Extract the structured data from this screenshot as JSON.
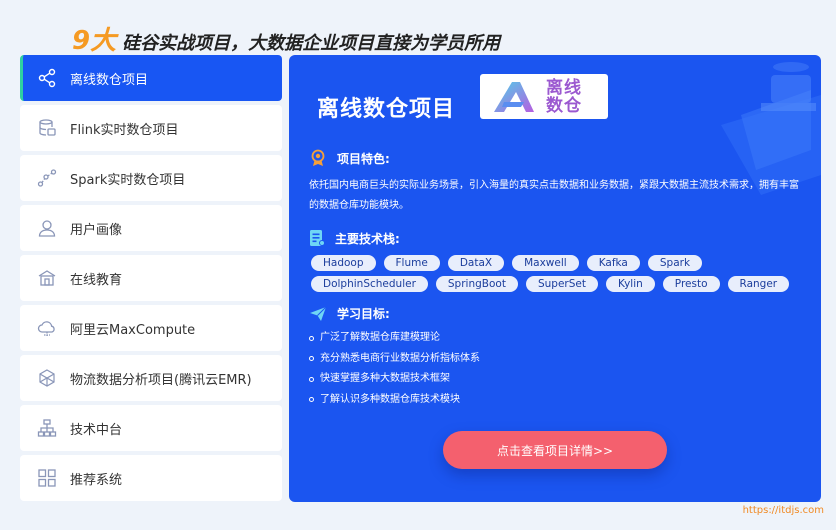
{
  "header": {
    "num": "9大",
    "rest": "硅谷实战项目，大数据企业项目直接为学员所用"
  },
  "sidebar": {
    "items": [
      {
        "label": "离线数仓项目",
        "icon": "share-nodes-icon"
      },
      {
        "label": "Flink实时数仓项目",
        "icon": "database-icon"
      },
      {
        "label": "Spark实时数仓项目",
        "icon": "spark-nodes-icon"
      },
      {
        "label": "用户画像",
        "icon": "user-icon"
      },
      {
        "label": "在线教育",
        "icon": "school-icon"
      },
      {
        "label": "阿里云MaxCompute",
        "icon": "cloud-icon"
      },
      {
        "label": "物流数据分析项目(腾讯云EMR)",
        "icon": "network-icon"
      },
      {
        "label": "技术中台",
        "icon": "hierarchy-icon"
      },
      {
        "label": "推荐系统",
        "icon": "grid-icon"
      }
    ]
  },
  "panel": {
    "title": "离线数仓项目",
    "logo_lines": [
      "离线",
      "数仓"
    ],
    "features_label": "项目特色:",
    "description": "依托国内电商巨头的实际业务场景，引入海量的真实点击数据和业务数据，紧跟大数据主流技术需求，拥有丰富的数据仓库功能模块。",
    "stack_label": "主要技术栈:",
    "tags": [
      "Hadoop",
      "Flume",
      "DataX",
      "Maxwell",
      "Kafka",
      "Spark",
      "DolphinScheduler",
      "SpringBoot",
      "SuperSet",
      "Kylin",
      "Presto",
      "Ranger"
    ],
    "goals_label": "学习目标:",
    "goals": [
      "广泛了解数据仓库建模理论",
      "充分熟悉电商行业数据分析指标体系",
      "快速掌握多种大数据技术框架",
      "了解认识多种数据仓库技术模块"
    ],
    "cta": "点击查看项目详情>>"
  },
  "watermark": "https://itdjs.com",
  "colors": {
    "accent": "#1b55f0",
    "active": "#1856f3",
    "cta": "#f4606e",
    "highlight": "#f59a23"
  }
}
